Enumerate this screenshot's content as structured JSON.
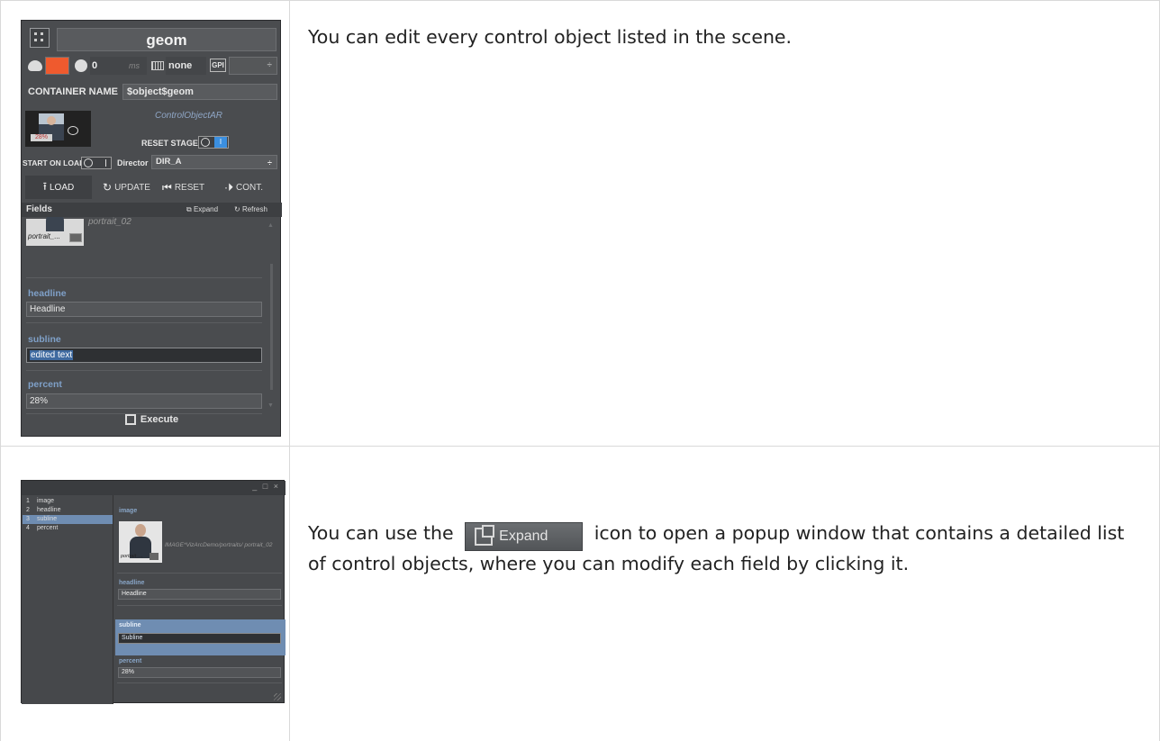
{
  "doc": {
    "row1_text": "You can edit every control object listed in the scene.",
    "row2_text_before": "You can use the",
    "row2_text_after": "icon to open a popup window that contains a detailed list of control objects, where you can modify each field by clicking it.",
    "expand_label": "Expand"
  },
  "panel1": {
    "title": "geom",
    "accent_color": "#ef5a2e",
    "delay_value": "0",
    "delay_unit": "ms",
    "layer_value": "none",
    "gpi_label": "GPI",
    "select_arrows": "÷",
    "container_name_label": "CONTAINER NAME",
    "container_name_value": "$object$geom",
    "control_object_type": "ControlObjectAR",
    "thumb_badge": "28%",
    "reset_stage_label": "RESET STAGE",
    "toggle_on": "I",
    "start_on_load_label": "START ON LOAD",
    "director_label": "Director",
    "director_value": "DIR_A",
    "actions": {
      "load": "LOAD",
      "update": "UPDATE",
      "reset": "RESET",
      "cont": "CONT."
    },
    "fields_title": "Fields",
    "fields_expand": "Expand",
    "fields_refresh": "Refresh",
    "fields": {
      "image_thumb_name": "portrait_...",
      "image_value": "portrait_02",
      "headline_label": "headline",
      "headline_value": "Headline",
      "subline_label": "subline",
      "subline_value": "edited text",
      "percent_label": "percent",
      "percent_value": "28%"
    },
    "execute_label": "Execute"
  },
  "panel2": {
    "window_controls": "_ □ ×",
    "list": [
      {
        "num": "1",
        "label": "image"
      },
      {
        "num": "2",
        "label": "headline"
      },
      {
        "num": "3",
        "label": "subline"
      },
      {
        "num": "4",
        "label": "percent"
      }
    ],
    "selected_index": 2,
    "image_label": "image",
    "image_thumb_name": "portrait_...",
    "image_path": "IMAGE*VizArcDemo/portraits/ portrait_02",
    "headline_label": "headline",
    "headline_value": "Headline",
    "subline_label": "subline",
    "subline_value": "Subline",
    "percent_label": "percent",
    "percent_value": "28%"
  }
}
